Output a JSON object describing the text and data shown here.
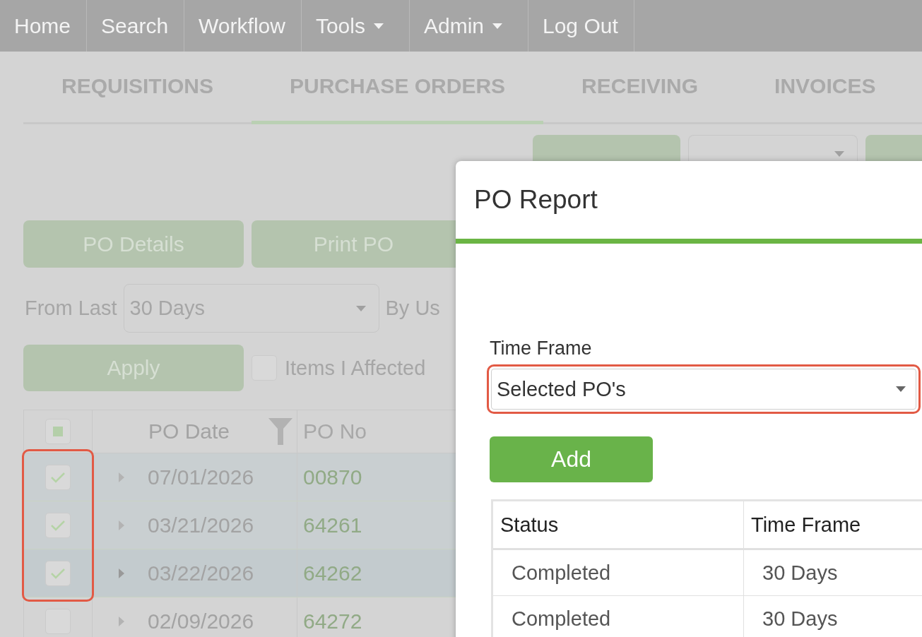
{
  "nav": [
    {
      "label": "Home",
      "dropdown": false
    },
    {
      "label": "Search",
      "dropdown": false
    },
    {
      "label": "Workflow",
      "dropdown": false
    },
    {
      "label": "Tools",
      "dropdown": true
    },
    {
      "label": "Admin",
      "dropdown": true
    },
    {
      "label": "Log Out",
      "dropdown": false
    }
  ],
  "tabs": [
    {
      "label": "REQUISITIONS",
      "selected": false
    },
    {
      "label": "PURCHASE ORDERS",
      "selected": true
    },
    {
      "label": "RECEIVING",
      "selected": false
    },
    {
      "label": "INVOICES",
      "selected": false
    }
  ],
  "actions": [
    "PO Details",
    "Print PO"
  ],
  "filters": {
    "from_label": "From Last",
    "from_value": "30 Days",
    "by_label": "By Us",
    "apply_button": "Apply",
    "items_affected": {
      "label": "Items I Affected",
      "checked": false
    }
  },
  "po_table": {
    "select_all_indeterminate": true,
    "checkbox_column_highlighted": true,
    "columns": [
      "PO Date",
      "PO No"
    ],
    "rows": [
      {
        "po_date": "07/01/2026",
        "po_no": "00870",
        "checked": true,
        "hovered": false
      },
      {
        "po_date": "03/21/2026",
        "po_no": "64261",
        "checked": true,
        "hovered": false
      },
      {
        "po_date": "03/22/2026",
        "po_no": "64262",
        "checked": true,
        "hovered": true
      },
      {
        "po_date": "02/09/2026",
        "po_no": "64272",
        "checked": false,
        "hovered": false
      }
    ]
  },
  "modal": {
    "title": "PO Report",
    "time_frame": {
      "label": "Time Frame",
      "value": "Selected PO's",
      "highlighted": true
    },
    "add_button": "Add",
    "table": {
      "columns": [
        "Status",
        "Time Frame"
      ],
      "rows": [
        [
          "Completed",
          "30 Days"
        ],
        [
          "Completed",
          "30 Days"
        ]
      ]
    }
  }
}
